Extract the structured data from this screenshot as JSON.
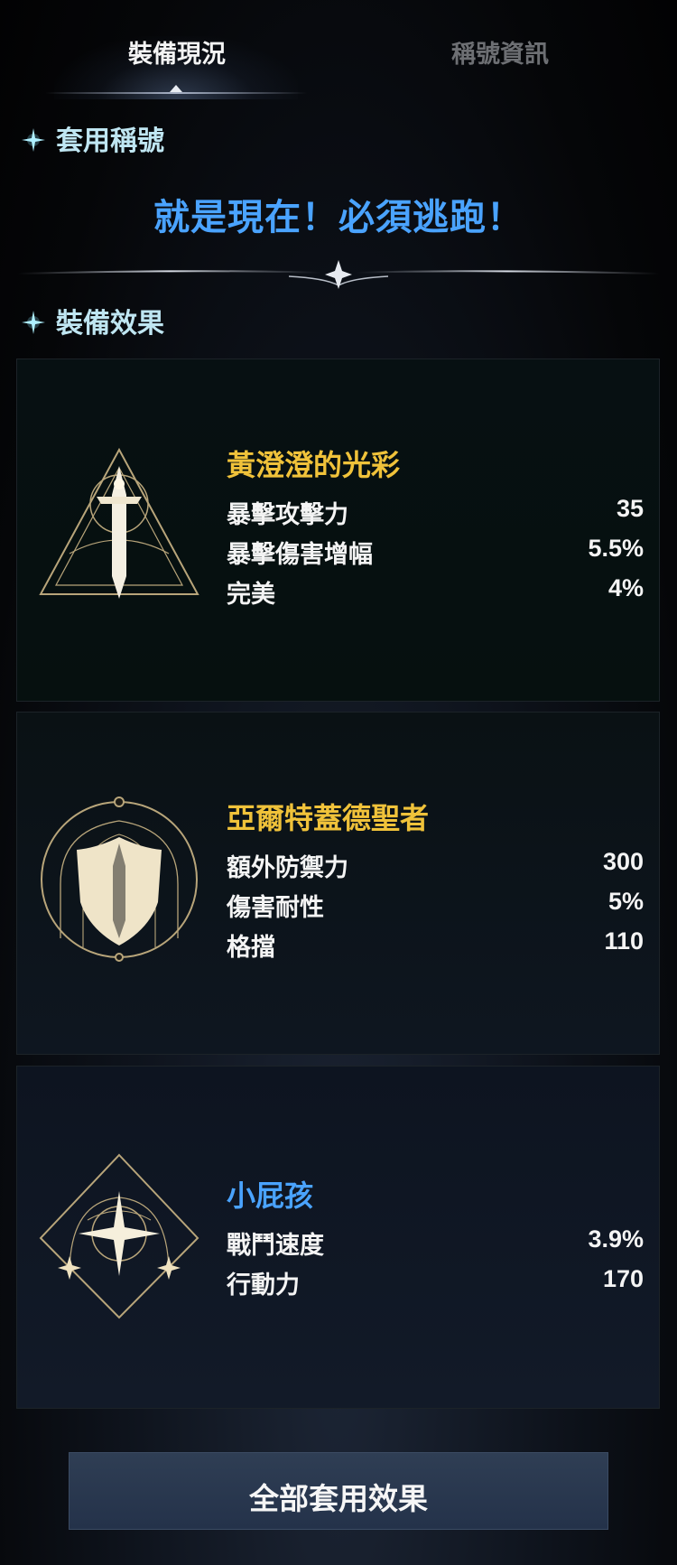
{
  "tabs": {
    "active": "裝備現況",
    "inactive": "稱號資訊"
  },
  "applied_title_section": {
    "header": "套用稱號",
    "title": "就是現在！必須逃跑！"
  },
  "equip_effect_section": {
    "header": "裝備效果"
  },
  "cards": [
    {
      "name": "黃澄澄的光彩",
      "icon": "sword-triangle-emblem-icon",
      "title_color": "#f0c23a",
      "stats": [
        {
          "label": "暴擊攻擊力",
          "value": "35"
        },
        {
          "label": "暴擊傷害增幅",
          "value": "5.5%"
        },
        {
          "label": "完美",
          "value": "4%"
        }
      ]
    },
    {
      "name": "亞爾特蓋德聖者",
      "icon": "shield-circle-emblem-icon",
      "title_color": "#f0c23a",
      "stats": [
        {
          "label": "額外防禦力",
          "value": "300"
        },
        {
          "label": "傷害耐性",
          "value": "5%"
        },
        {
          "label": "格擋",
          "value": "110"
        }
      ]
    },
    {
      "name": "小屁孩",
      "icon": "star-diamond-emblem-icon",
      "title_color": "#4aa3ff",
      "stats": [
        {
          "label": "戰鬥速度",
          "value": "3.9%"
        },
        {
          "label": "行動力",
          "value": "170"
        }
      ]
    }
  ],
  "footer": {
    "button_label": "全部套用效果"
  },
  "colors": {
    "accent_blue": "#4aa3ff",
    "gold": "#f0c23a",
    "section_header": "#bfe6f2"
  }
}
